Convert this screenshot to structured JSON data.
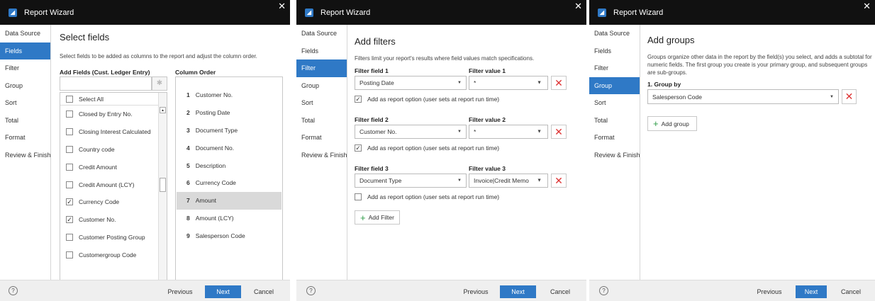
{
  "app_title": "Report Wizard",
  "nav": [
    "Data Source",
    "Fields",
    "Filter",
    "Group",
    "Sort",
    "Total",
    "Format",
    "Review & Finish"
  ],
  "footer": {
    "help": "?",
    "previous": "Previous",
    "next": "Next",
    "cancel": "Cancel"
  },
  "close_glyph": "✕",
  "fields_panel": {
    "selected_nav": 1,
    "title": "Select fields",
    "description": "Select fields to be added as columns to the report and adjust the column order.",
    "add_fields_label": "Add Fields (Cust. Ledger Entry)",
    "column_order_label": "Column Order",
    "search_value": "",
    "select_all": "Select All",
    "field_items": [
      {
        "label": "Closed by Entry No.",
        "checked": false
      },
      {
        "label": "Closing Interest Calculated",
        "checked": false
      },
      {
        "label": "Country code",
        "checked": false
      },
      {
        "label": "Credit Amount",
        "checked": false
      },
      {
        "label": "Credit Amount (LCY)",
        "checked": false
      },
      {
        "label": "Currency Code",
        "checked": true
      },
      {
        "label": "Customer No.",
        "checked": true
      },
      {
        "label": "Customer Posting Group",
        "checked": false
      },
      {
        "label": "Customergroup Code",
        "checked": false
      }
    ],
    "column_order": [
      {
        "num": "1",
        "label": "Customer No."
      },
      {
        "num": "2",
        "label": "Posting Date"
      },
      {
        "num": "3",
        "label": "Document Type"
      },
      {
        "num": "4",
        "label": "Document No."
      },
      {
        "num": "5",
        "label": "Description"
      },
      {
        "num": "6",
        "label": "Currency Code"
      },
      {
        "num": "7",
        "label": "Amount"
      },
      {
        "num": "8",
        "label": "Amount (LCY)"
      },
      {
        "num": "9",
        "label": "Salesperson Code"
      }
    ],
    "highlighted_column_index": 6
  },
  "filter_panel": {
    "selected_nav": 2,
    "title": "Add filters",
    "description": "Filters limit your report's results where field values match specifications.",
    "filters": [
      {
        "field_label": "Filter field 1",
        "value_label": "Filter value 1",
        "field": "Posting Date",
        "value": "*",
        "report_option": "Add as report option (user sets at report run time)",
        "checked": true
      },
      {
        "field_label": "Filter field 2",
        "value_label": "Filter value 2",
        "field": "Customer No.",
        "value": "*",
        "report_option": "Add as report option (user sets at report run time)",
        "checked": true
      },
      {
        "field_label": "Filter field 3",
        "value_label": "Filter value 3",
        "field": "Document Type",
        "value": "Invoice|Credit Memo",
        "report_option": "Add as report option (user sets at report run time)",
        "checked": false
      }
    ],
    "add_filter": "Add Filter"
  },
  "group_panel": {
    "selected_nav": 3,
    "title": "Add groups",
    "description": "Groups organize other data in the report by the field(s) you select, and adds a subtotal for numeric fields. The first group you create is your primary group, and subsequent groups are sub-groups.",
    "group_label": "1. Group by",
    "group_value": "Salesperson Code",
    "add_group": "Add group"
  },
  "colors": {
    "accent": "#2f79c6",
    "titlebar": "#111111",
    "remove": "#d33333",
    "add": "#2e9b46"
  }
}
